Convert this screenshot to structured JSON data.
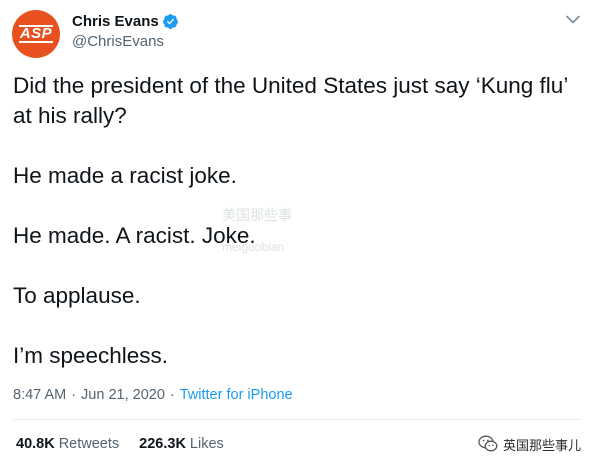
{
  "user": {
    "avatar_text": "ASP",
    "display_name": "Chris Evans",
    "handle": "@ChrisEvans"
  },
  "tweet": {
    "paragraphs": [
      "Did the president of the United States just say ‘Kung flu’ at his rally?",
      "He made a racist joke.",
      "He made. A racist. Joke.",
      "To applause.",
      "I’m speechless."
    ],
    "time": "8:47 AM",
    "date": "Jun 21, 2020",
    "source": "Twitter for iPhone"
  },
  "stats": {
    "retweets_count": "40.8K",
    "retweets_label": "Retweets",
    "likes_count": "226.3K",
    "likes_label": "Likes"
  },
  "watermark": {
    "line1": "美国那些事",
    "line2": "meiguobian"
  },
  "wechat": {
    "label": "英国那些事儿"
  },
  "colors": {
    "avatar_bg": "#e8501f",
    "verified": "#1d9bf0",
    "link": "#1d9bf0",
    "muted": "#536471",
    "text": "#0f1419"
  },
  "icons": [
    "verified-badge-icon",
    "chevron-down-icon",
    "wechat-icon"
  ]
}
